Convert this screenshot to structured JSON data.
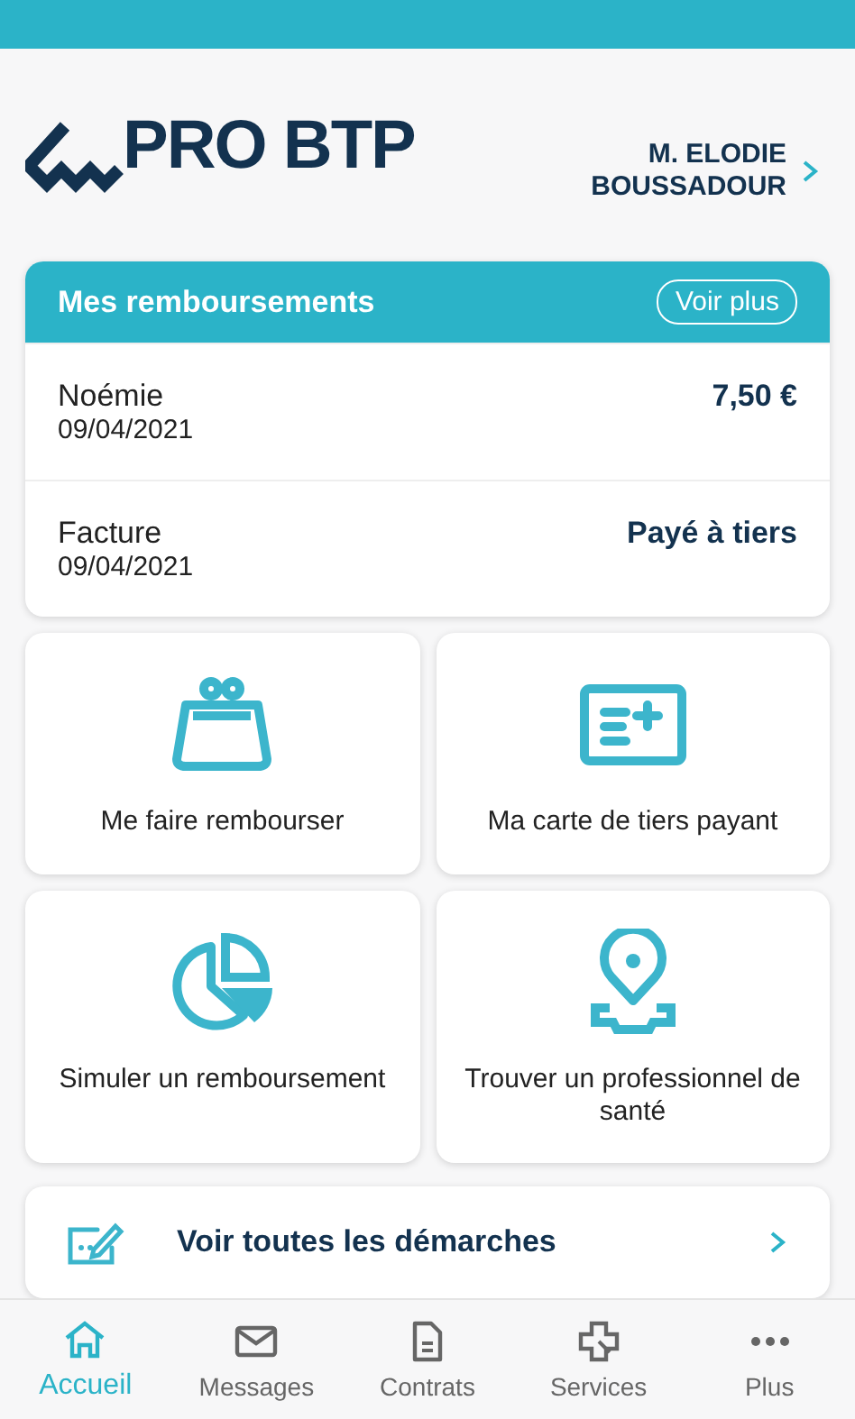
{
  "logo": {
    "text": "PRO BTP"
  },
  "user": {
    "name_line_1": "M. ELODIE",
    "name_line_2": "BOUSSADOUR"
  },
  "reimbursements": {
    "title": "Mes remboursements",
    "button": "Voir plus",
    "rows": [
      {
        "label": "Noémie",
        "date": "09/04/2021",
        "value": "7,50 €"
      },
      {
        "label": "Facture",
        "date": "09/04/2021",
        "value": "Payé à tiers"
      }
    ]
  },
  "actions": [
    {
      "kind": "purse",
      "label": "Me faire rembourser"
    },
    {
      "kind": "card",
      "label": "Ma carte de tiers payant"
    },
    {
      "kind": "pie",
      "label": "Simuler un remboursement"
    },
    {
      "kind": "pin",
      "label": "Trouver un professionnel de santé"
    }
  ],
  "all_steps": {
    "label": "Voir toutes les démarches"
  },
  "nav": [
    {
      "kind": "home",
      "label": "Accueil",
      "selected": true
    },
    {
      "kind": "mail",
      "label": "Messages",
      "selected": false
    },
    {
      "kind": "doc",
      "label": "Contrats",
      "selected": false
    },
    {
      "kind": "cross",
      "label": "Services",
      "selected": false
    },
    {
      "kind": "dots",
      "label": "Plus",
      "selected": false
    }
  ]
}
